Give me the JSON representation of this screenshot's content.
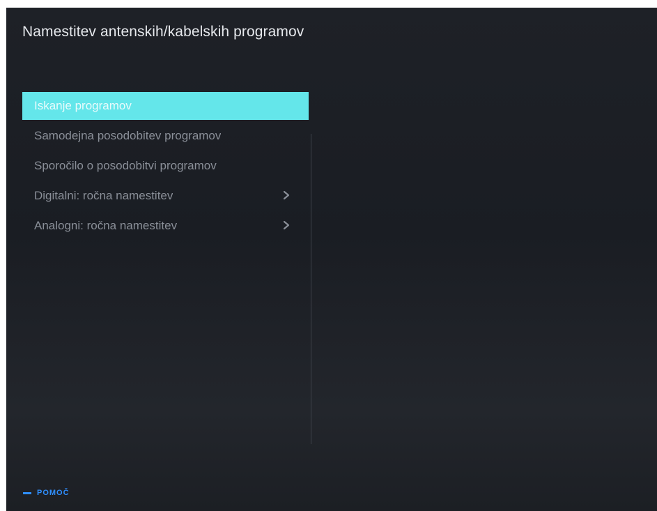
{
  "header": {
    "title": "Namestitev antenskih/kabelskih programov"
  },
  "menu": {
    "items": [
      {
        "label": "Iskanje programov",
        "selected": true,
        "has_submenu": false
      },
      {
        "label": "Samodejna posodobitev programov",
        "selected": false,
        "has_submenu": false
      },
      {
        "label": "Sporočilo o posodobitvi programov",
        "selected": false,
        "has_submenu": false
      },
      {
        "label": "Digitalni: ročna namestitev",
        "selected": false,
        "has_submenu": true
      },
      {
        "label": "Analogni: ročna namestitev",
        "selected": false,
        "has_submenu": true
      }
    ]
  },
  "footer": {
    "help_label": "POMOČ",
    "help_icon": "minus-key-icon"
  },
  "colors": {
    "background": "#1e2127",
    "selection": "#64e6ea",
    "text": "#8a8f98",
    "title": "#e6e8ec",
    "help_accent": "#2f8fff"
  }
}
